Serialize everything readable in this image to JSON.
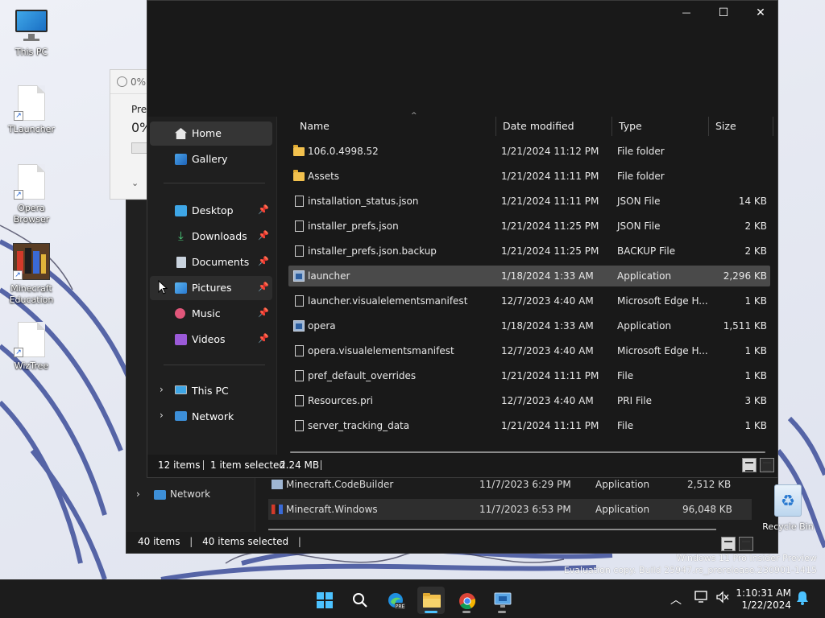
{
  "desktop": {
    "icons": [
      {
        "label": "This PC"
      },
      {
        "label": "TLauncher"
      },
      {
        "label": "Opera Browser"
      },
      {
        "label": "Minecraft Education"
      },
      {
        "label": "WizTree"
      }
    ],
    "recycle_bin": "Recycle Bin",
    "watermark_line1": "Windows 11 Pro Insider Preview",
    "watermark_line2": "Evaluation copy. Build 25947.rs_prerelease.230901-1415"
  },
  "bg_progress": {
    "title": "0%",
    "line1": "Prep",
    "line2": "0%"
  },
  "bg_explorer": {
    "nav_network": "Network",
    "rows": [
      {
        "name": "Minecraft.CodeBuilder",
        "date": "11/7/2023 6:29 PM",
        "type": "Application",
        "size": "2,512 KB"
      },
      {
        "name": "Minecraft.Windows",
        "date": "11/7/2023 6:53 PM",
        "type": "Application",
        "size": "96,048 KB"
      }
    ],
    "status_items": "40 items",
    "status_selected": "40 items selected"
  },
  "explorer": {
    "window_controls": {
      "minimize": "—",
      "maximize": "☐",
      "close": "✕"
    },
    "nav": {
      "home": "Home",
      "gallery": "Gallery",
      "desktop": "Desktop",
      "downloads": "Downloads",
      "documents": "Documents",
      "pictures": "Pictures",
      "music": "Music",
      "videos": "Videos",
      "this_pc": "This PC",
      "network": "Network"
    },
    "columns": {
      "name": "Name",
      "date": "Date modified",
      "type": "Type",
      "size": "Size"
    },
    "files": [
      {
        "name": "106.0.4998.52",
        "date": "1/21/2024 11:12 PM",
        "type": "File folder",
        "size": "",
        "icon": "folder"
      },
      {
        "name": "Assets",
        "date": "1/21/2024 11:11 PM",
        "type": "File folder",
        "size": "",
        "icon": "folder"
      },
      {
        "name": "installation_status.json",
        "date": "1/21/2024 11:11 PM",
        "type": "JSON File",
        "size": "14 KB",
        "icon": "doc"
      },
      {
        "name": "installer_prefs.json",
        "date": "1/21/2024 11:25 PM",
        "type": "JSON File",
        "size": "2 KB",
        "icon": "doc"
      },
      {
        "name": "installer_prefs.json.backup",
        "date": "1/21/2024 11:25 PM",
        "type": "BACKUP File",
        "size": "2 KB",
        "icon": "doc"
      },
      {
        "name": "launcher",
        "date": "1/18/2024 1:33 AM",
        "type": "Application",
        "size": "2,296 KB",
        "icon": "app"
      },
      {
        "name": "launcher.visualelementsmanifest",
        "date": "12/7/2023 4:40 AM",
        "type": "Microsoft Edge H...",
        "size": "1 KB",
        "icon": "doc"
      },
      {
        "name": "opera",
        "date": "1/18/2024 1:33 AM",
        "type": "Application",
        "size": "1,511 KB",
        "icon": "app"
      },
      {
        "name": "opera.visualelementsmanifest",
        "date": "12/7/2023 4:40 AM",
        "type": "Microsoft Edge H...",
        "size": "1 KB",
        "icon": "doc"
      },
      {
        "name": "pref_default_overrides",
        "date": "1/21/2024 11:11 PM",
        "type": "File",
        "size": "1 KB",
        "icon": "doc"
      },
      {
        "name": "Resources.pri",
        "date": "12/7/2023 4:40 AM",
        "type": "PRI File",
        "size": "3 KB",
        "icon": "doc"
      },
      {
        "name": "server_tracking_data",
        "date": "1/21/2024 11:11 PM",
        "type": "File",
        "size": "1 KB",
        "icon": "doc"
      }
    ],
    "selected_index": 5,
    "status": {
      "items": "12 items",
      "selected": "1 item selected",
      "size": "2.24 MB"
    }
  },
  "taskbar": {
    "time": "1:10:31 AM",
    "date": "1/22/2024",
    "icons": [
      "windows-start-icon",
      "search-icon",
      "edge-preview-icon",
      "file-explorer-icon",
      "chrome-icon",
      "remote-desktop-icon"
    ]
  },
  "colors": {
    "accent": "#4cc2ff",
    "folder": "#f2c14e",
    "selected_row": "#4a4a4a"
  }
}
